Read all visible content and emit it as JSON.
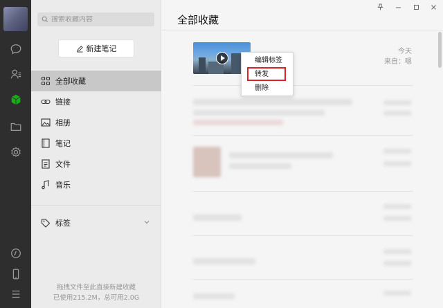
{
  "sidebar": {
    "search_placeholder": "搜索收藏内容",
    "new_note_label": "新建笔记",
    "nav": [
      {
        "label": "全部收藏",
        "icon": "grid-icon",
        "active": true
      },
      {
        "label": "链接",
        "icon": "link-icon",
        "active": false
      },
      {
        "label": "相册",
        "icon": "image-icon",
        "active": false
      },
      {
        "label": "笔记",
        "icon": "note-icon",
        "active": false
      },
      {
        "label": "文件",
        "icon": "file-icon",
        "active": false
      },
      {
        "label": "音乐",
        "icon": "music-icon",
        "active": false
      }
    ],
    "tags_label": "标签",
    "footer_line1": "拖拽文件至此直接新建收藏",
    "footer_line2": "已使用215.2M，总可用2.0G"
  },
  "main": {
    "title": "全部收藏",
    "item": {
      "date": "今天",
      "source": "来自：嗯"
    },
    "context_menu": [
      {
        "label": "编辑标签"
      },
      {
        "label": "转发",
        "highlighted": true
      },
      {
        "label": "删除"
      }
    ]
  },
  "colors": {
    "rail_bg": "#2e2e2e",
    "sidebar_bg": "#ebebeb",
    "accent_green": "#1aad19",
    "highlight_red": "#d9222a"
  }
}
